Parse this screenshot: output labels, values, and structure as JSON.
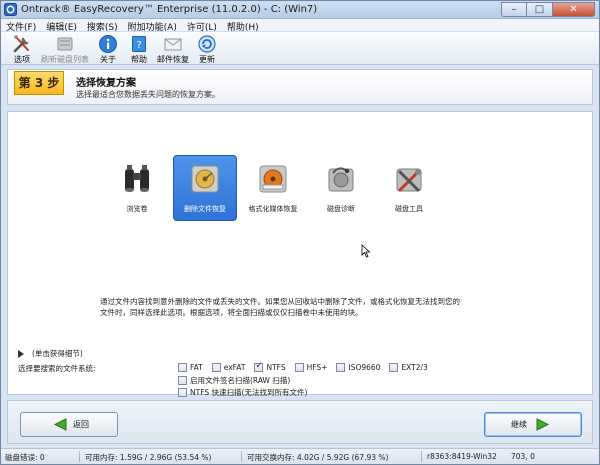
{
  "window": {
    "title": "Ontrack® EasyRecovery™ Enterprise (11.0.2.0) - C: (Win7)",
    "controls": {
      "minimize": "–",
      "maximize": "□",
      "close": "✕"
    }
  },
  "menu": [
    "文件(F)",
    "编辑(E)",
    "搜索(S)",
    "附加功能(A)",
    "许可(L)",
    "帮助(H)"
  ],
  "toolbar": [
    {
      "label": "选项",
      "icon": "options-tools-icon",
      "enabled": true
    },
    {
      "label": "刷新磁盘列表",
      "icon": "refresh-disk-list-icon",
      "enabled": false
    },
    {
      "label": "关于",
      "icon": "about-info-icon",
      "enabled": true
    },
    {
      "label": "帮助",
      "icon": "help-book-icon",
      "enabled": true
    },
    {
      "label": "邮件恢复",
      "icon": "email-recovery-icon",
      "enabled": true
    },
    {
      "label": "更新",
      "icon": "update-icon",
      "enabled": true
    }
  ],
  "step": {
    "number": "第 3 步",
    "title": "选择恢复方案",
    "description": "选择最适合您数据丢失问题的恢复方案。"
  },
  "options": [
    {
      "label": "浏览卷",
      "icon": "binoculars-icon",
      "selected": false
    },
    {
      "label": "删除文件恢复",
      "icon": "deleted-file-recovery-icon",
      "selected": true
    },
    {
      "label": "格式化媒体恢复",
      "icon": "formatted-media-recovery-icon",
      "selected": false
    },
    {
      "label": "磁盘诊断",
      "icon": "disk-diagnostics-icon",
      "selected": false
    },
    {
      "label": "磁盘工具",
      "icon": "disk-tools-icon",
      "selected": false
    }
  ],
  "option_description": "通过文件内容找到意外删除的文件或丢失的文件。如果您从回收站中删除了文件，或格式化恢复无法找到您的文件时，同样选择此选项。根据选项，将全面扫描或仅仅扫描卷中未使用的块。",
  "details_toggle": "(单击获得细节)",
  "filesystem_label": "选择要搜索的文件系统:",
  "filesystems": [
    {
      "label": "FAT",
      "checked": false
    },
    {
      "label": "exFAT",
      "checked": false
    },
    {
      "label": "NTFS",
      "checked": true
    },
    {
      "label": "HFS+",
      "checked": false
    },
    {
      "label": "ISO9660",
      "checked": false
    },
    {
      "label": "EXT2/3",
      "checked": false
    }
  ],
  "extra_options": [
    {
      "label": "启用文件签名扫描(RAW 扫描)",
      "checked": false
    },
    {
      "label": "NTFS 快速扫描(无法找到所有文件)",
      "checked": false
    }
  ],
  "nav": {
    "back": "返回",
    "next": "继续"
  },
  "status": {
    "disk_errors": "磁盘错误: 0",
    "memory": "可用内存: 1.59G / 2.96G (53.54 %)",
    "swap": "可用交换内存: 4.02G / 5.92G (67.93 %)",
    "build": "r8363:8419-Win32",
    "code": "703, 0"
  }
}
